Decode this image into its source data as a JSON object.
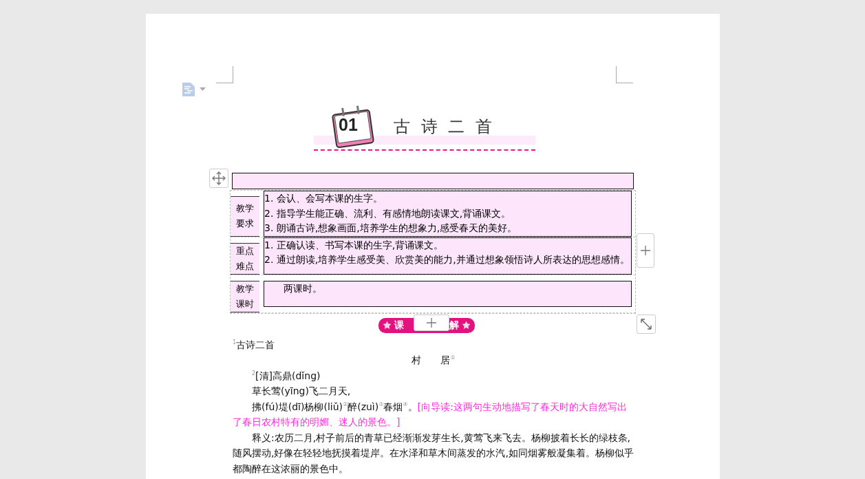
{
  "header": {
    "number": "01",
    "title": "古诗二首"
  },
  "table": {
    "rows": [
      {
        "label": [
          "教学",
          "要求"
        ],
        "lines": [
          "1. 会认、会写本课的生字。",
          "2. 指导学生能正确、流利、有感情地朗读课文,背诵课文。",
          "3. 朗诵古诗,想象画面,培养学生的想象力,感受春天的美好。"
        ],
        "indent": false
      },
      {
        "label": [
          "重点",
          "难点"
        ],
        "lines": [
          "1. 正确认读、书写本课的生字,背诵课文。",
          "2. 通过朗读,培养学生感受美、欣赏美的能力,并通过想象领悟诗人所表达的思想感情。"
        ],
        "indent": false
      },
      {
        "label": [
          "教学",
          "课时"
        ],
        "lines": [
          "两课时。"
        ],
        "indent": true
      }
    ]
  },
  "badge": {
    "left": "课",
    "right": "解"
  },
  "body": [
    {
      "kind": "plain",
      "text": "$^{1}$古诗二首"
    },
    {
      "kind": "center",
      "text": "村　　居$^{①}$"
    },
    {
      "kind": "indent",
      "text": "$^{2}$[清]高鼎(dǐng)"
    },
    {
      "kind": "indent",
      "text": "草长莺(yīng)飞二月天,"
    },
    {
      "kind": "guided",
      "text": "拂(fú)堤(dī)杨柳(liǔ)$^{②}$醉(zuì)$^{③}$春烟$^{④}$。",
      "note": "[向导读:这两句生动地描写了春天时的大自然写出了春日农村特有的明媚、迷人的景色。]"
    },
    {
      "kind": "indent",
      "text": "释义:农历二月,村子前后的青草已经渐渐发芽生长,黄莺飞来飞去。杨柳披着长长的绿枝条,随风摆动,好像在轻轻地抚摸着堤岸。在水泽和草木间蒸发的水汽,如同烟雾般凝集着。杨柳似乎都陶醉在这浓丽的景色中。"
    }
  ]
}
